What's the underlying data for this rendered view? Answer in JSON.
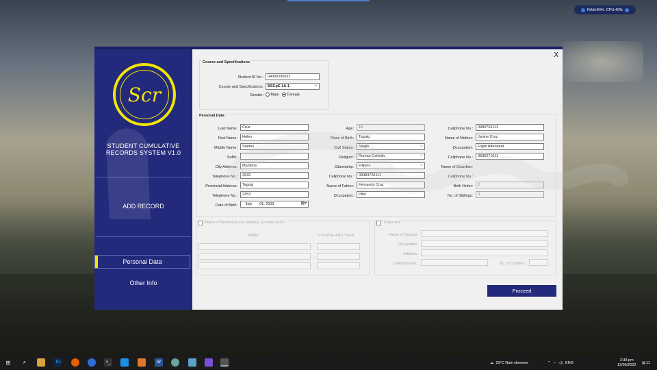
{
  "status_widget": {
    "ram": "RAM:84%",
    "cpu": "CPU:40%"
  },
  "sidebar": {
    "logo_text": "Scr",
    "system_title_line1": "STUDENT CUMULATIVE",
    "system_title_line2": "RECORDS SYSTEM V1.0",
    "nav_add_record": "ADD RECORD",
    "nav_personal_data": "Personal Data",
    "nav_other_info": "Other Info"
  },
  "window": {
    "close_label": "X"
  },
  "course": {
    "group_title": "Course and Specifications",
    "student_id_label": "Student ID No.:",
    "student_id_value": "04000293621",
    "course_label": "Course and Specifications:",
    "course_value": "BSCpE 1A-1",
    "gender_label": "Gender:",
    "gender_male": "Male",
    "gender_female": "Female",
    "gender_selected": "Female"
  },
  "personal": {
    "group_title": "Personal Data",
    "left": [
      {
        "label": "Last Name:",
        "value": "Cruz"
      },
      {
        "label": "First Name:",
        "value": "Helen"
      },
      {
        "label": "Middle Name:",
        "value": "Santos"
      },
      {
        "label": "Suffix:",
        "value": ""
      },
      {
        "label": "City Address:",
        "value": "Marikina"
      },
      {
        "label": "Telephone No.:",
        "value": "2532"
      },
      {
        "label": "Provincial Address:",
        "value": "Taguig"
      },
      {
        "label": "Telephone No.:",
        "value": "2353"
      }
    ],
    "dob_label": "Date of Birth:",
    "dob_month": "July",
    "dob_day_year": "01, 2003",
    "middle": {
      "age_label": "Age:",
      "age_value": "18",
      "pob_label": "Place of Birth:",
      "pob_value": "Taguig",
      "civil_label": "Civil Status:",
      "civil_value": "Single",
      "religion_label": "Religion:",
      "religion_value": "Roman Catholic",
      "citizenship_label": "Citizenship:",
      "citizenship_value": "Filipino",
      "cellphone_label": "Cellphone No.:",
      "cellphone_value": "09983726111",
      "father_label": "Name of Father:",
      "father_value": "Fernando Cruz",
      "occupation_label": "Occupation:",
      "occupation_value": "Pilot"
    },
    "right": {
      "cell1_label": "Cellphone No.:",
      "cell1_value": "0983726112",
      "mother_label": "Name of Mother:",
      "mother_value": "Janine Cruz",
      "occ_label": "Occupation:",
      "occ_value": "Flight Attendant",
      "cell2_label": "Cellphone No.:",
      "cell2_value": "0936271611",
      "guardian_label": "Name of Guardian:",
      "guardian_value": "",
      "cell3_label": "Cellphone No.:",
      "cell3_value": "",
      "order_label": "Birth Order:",
      "order_value": "2",
      "siblings_label": "No. of Siblings:",
      "siblings_value": "3"
    }
  },
  "siblings": {
    "checkbox_label": "Name of Brother(s) and Sister(s) Enrolled at STI",
    "col_name": "NAME",
    "col_course": "COURSE AND YEAR"
  },
  "married": {
    "checkbox_label": "If Married",
    "spouse_label": "Name of Spouse:",
    "occupation_label": "Occupation:",
    "address_label": "Address:",
    "cellphone_label": "Cellphone No.:",
    "children_label": "No. of Children:"
  },
  "proceed_label": "Proceed",
  "taskbar": {
    "weather": "23°C  Rain showers",
    "lang": "ENG",
    "time": "2:38 pm",
    "date": "12/06/2022",
    "notif_count": "11"
  }
}
